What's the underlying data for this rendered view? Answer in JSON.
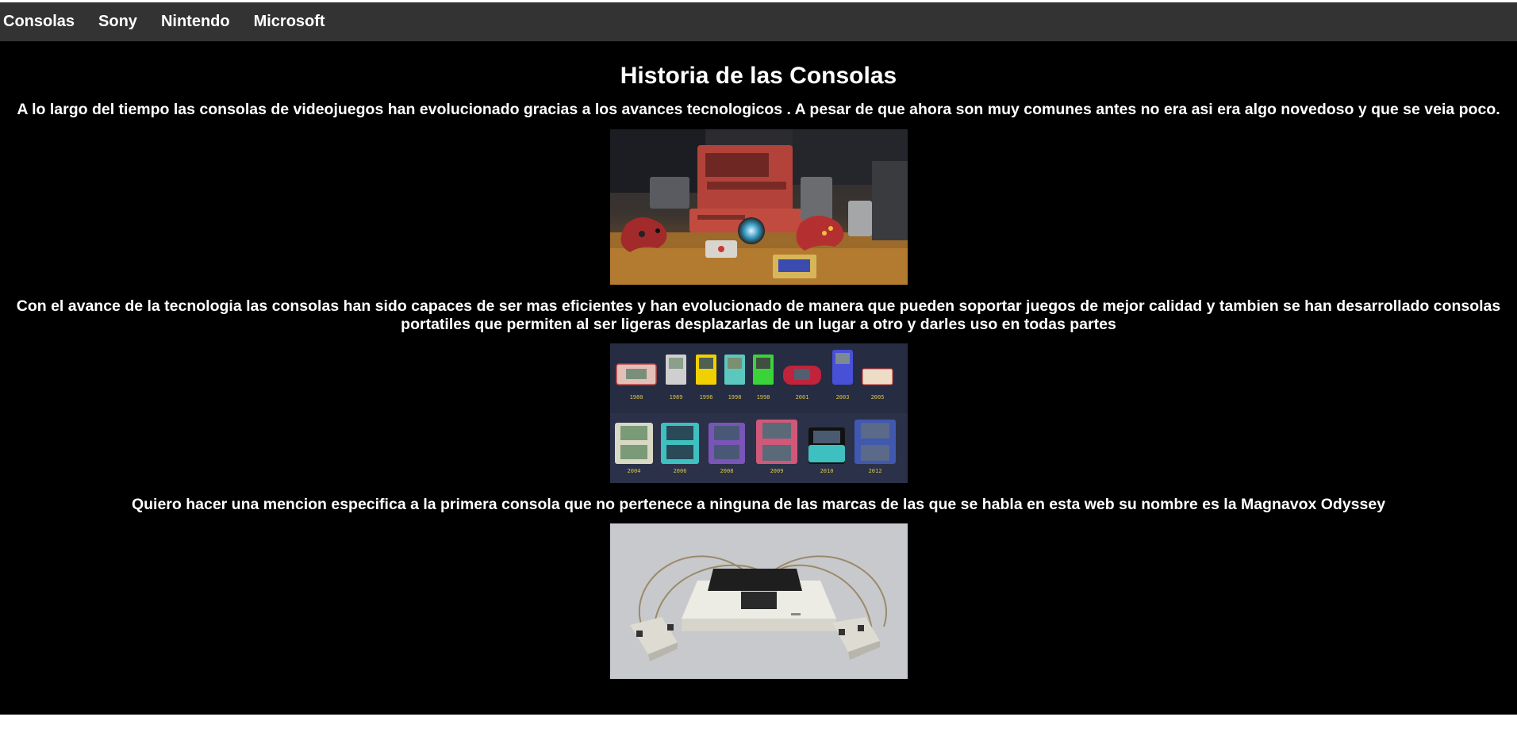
{
  "nav": {
    "items": [
      {
        "label": "Consolas"
      },
      {
        "label": "Sony"
      },
      {
        "label": "Nintendo"
      },
      {
        "label": "Microsoft"
      }
    ]
  },
  "main": {
    "title": "Historia de las Consolas",
    "paragraph1": "A lo largo del tiempo las consolas de videojuegos han evolucionado gracias a los avances tecnologicos . A pesar de que ahora son muy comunes antes no era asi era algo novedoso y que se veia poco.",
    "paragraph2": "Con el avance de la tecnologia las consolas han sido capaces de ser mas eficientes y han evolucionado de manera que pueden soportar juegos de mejor calidad y tambien se han desarrollado consolas portatiles que permiten al ser ligeras desplazarlas de un lugar a otro y darles uso en todas partes",
    "paragraph3": "Quiero hacer una mencion especifica a la primera consola que no pertenece a ninguna de las marcas de las que se habla en esta web su nombre es la Magnavox Odyssey",
    "handheld_years": [
      "1980",
      "1989",
      "1996",
      "1998",
      "1998",
      "2001",
      "2003",
      "2005",
      "2004",
      "2006",
      "2008",
      "2009",
      "2010",
      "2012"
    ]
  },
  "colors": {
    "nav_bg": "#333333",
    "page_bg": "#000000",
    "text": "#ffffff"
  }
}
